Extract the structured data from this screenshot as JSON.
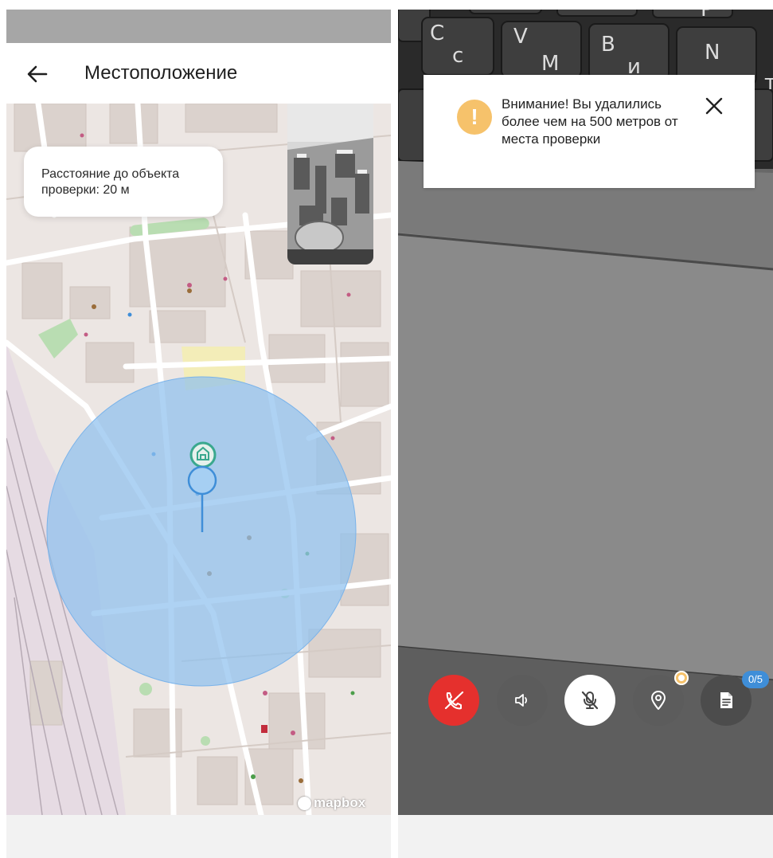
{
  "left_screen": {
    "header": {
      "back_icon": "arrow-left-icon",
      "title": "Местоположение"
    },
    "map": {
      "distance_card_text": "Расстояние до объекта проверки: 20 м",
      "attribution": "mapbox",
      "radius_circle_color": "#8fc0ef",
      "marker_color": "#3f8ed8",
      "object_marker_icon": "house-check-icon"
    }
  },
  "right_screen": {
    "alert": {
      "icon": "exclamation-icon",
      "text": "Внимание! Вы удалились более чем на 500 метров от места проверки",
      "close_icon": "close-icon",
      "accent_color": "#f6c26b"
    },
    "controls": {
      "hangup_icon": "phone-off-icon",
      "speaker_icon": "speaker-icon",
      "mic_icon": "mic-off-icon",
      "location_icon": "map-pin-icon",
      "documents_icon": "document-icon",
      "documents_badge": "0/5",
      "hangup_color": "#e5302d"
    }
  }
}
